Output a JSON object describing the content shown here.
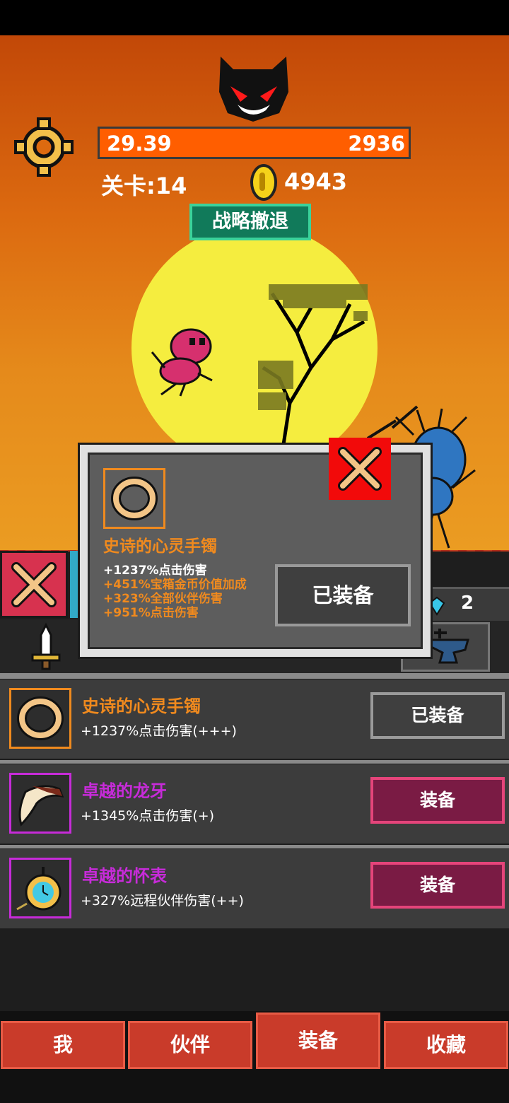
{
  "hud": {
    "hp_current": "29.39",
    "hp_max": "2936",
    "level": "关卡:14",
    "gold": "4943",
    "retreat_button": "战略撤退",
    "gem_count": "2"
  },
  "popup": {
    "item_name": "史诗的心灵手镯",
    "stats": [
      {
        "text": "+1237%点击伤害",
        "color": "#ffffff"
      },
      {
        "text": "+451%宝箱金币价值加成",
        "color": "#f08a1e"
      },
      {
        "text": "+323%全部伙伴伤害",
        "color": "#f08a1e"
      },
      {
        "text": "+951%点击伤害",
        "color": "#f08a1e"
      }
    ],
    "button": "已装备"
  },
  "items": [
    {
      "name": "史诗的心灵手镯",
      "desc": "+1237%点击伤害(+++)",
      "button": "已装备",
      "rarity_color": "#f08a1e",
      "icon": "bracelet-icon"
    },
    {
      "name": "卓越的龙牙",
      "desc": "+1345%点击伤害(+)",
      "button": "装备",
      "rarity_color": "#c72bd9",
      "icon": "dragon-fang-icon"
    },
    {
      "name": "卓越的怀表",
      "desc": "+327%远程伙伴伤害(++)",
      "button": "装备",
      "rarity_color": "#c72bd9",
      "icon": "pocket-watch-icon"
    }
  ],
  "tabs": [
    "我",
    "伙伴",
    "装备",
    "收藏"
  ],
  "active_tab": "装备",
  "colors": {
    "hp_bar": "#ff5e00",
    "epic": "#f08a1e",
    "excellent": "#c72bd9",
    "retreat": "#117a5a",
    "tab": "#c93b2a"
  }
}
